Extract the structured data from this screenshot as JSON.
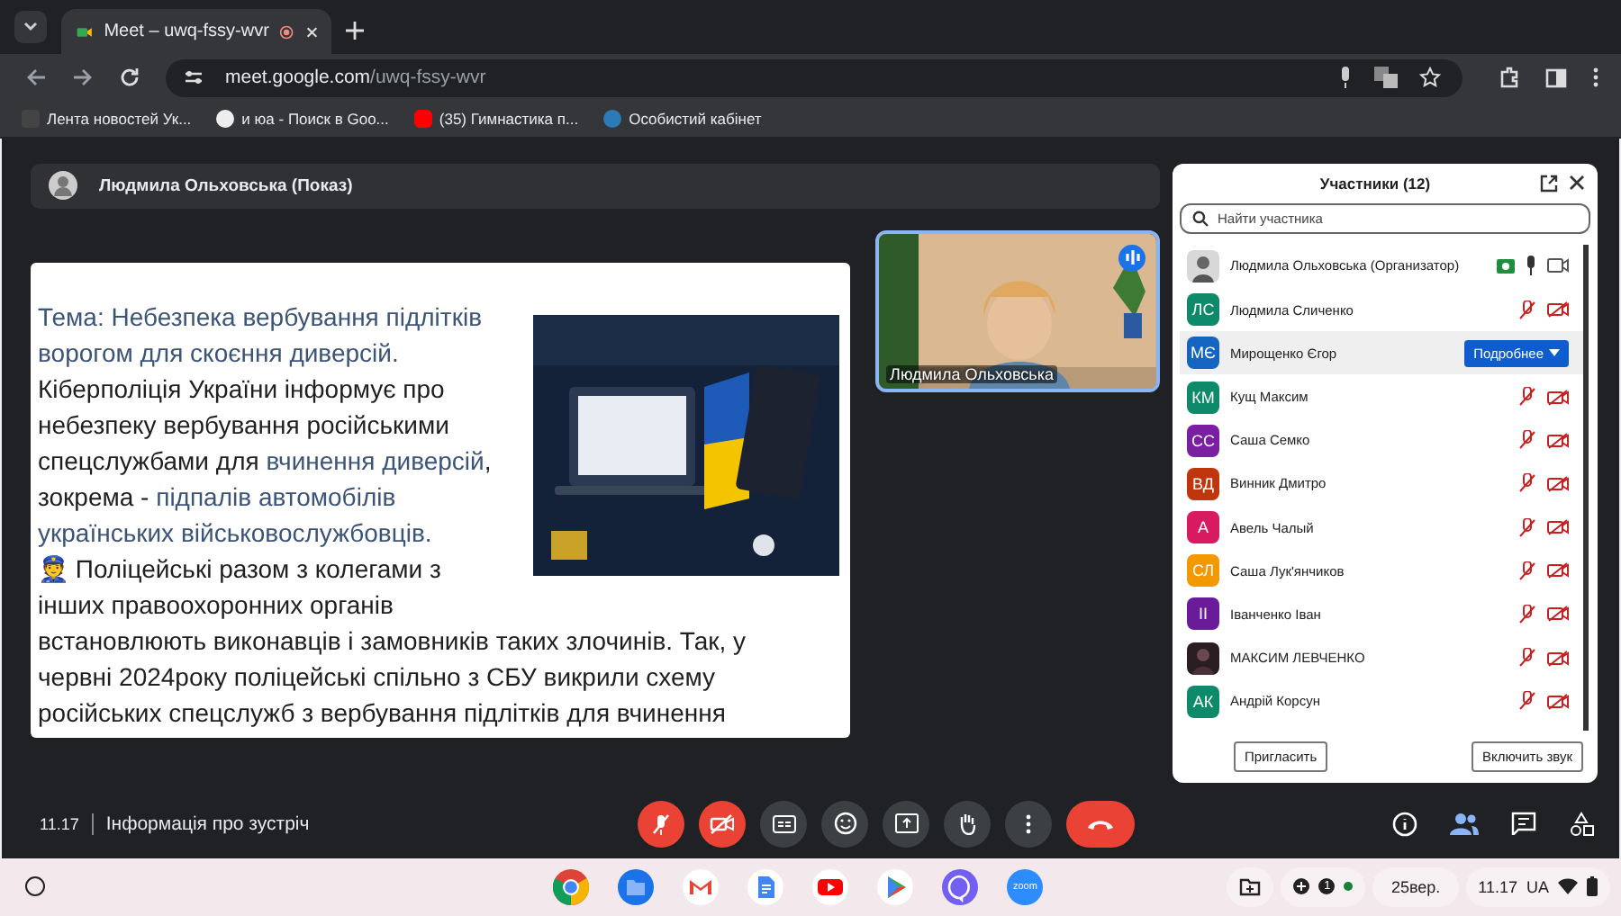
{
  "browser": {
    "tab": {
      "title": "Meet – uwq-fssy-wvr",
      "recording": true
    },
    "url": {
      "host": "meet.google.com",
      "path": "/uwq-fssy-wvr"
    },
    "bookmarks": [
      {
        "label": "Лента новостей Ук..."
      },
      {
        "label": "и юа - Поиск в Goo..."
      },
      {
        "label": "(35) Гимнастика п..."
      },
      {
        "label": "Особистий кабінет"
      }
    ]
  },
  "presenter_bar": {
    "label": "Людмила Ольховська (Показ)"
  },
  "slide": {
    "bottom_text": "встановлюють виконавців і замовників таких злочинів. Так, у червні 2024року поліцейські спільно з СБУ викрили схему російських спецслужб з вербування підлітків для вчинення",
    "paragraphs": [
      {
        "segments": [
          {
            "text": "Тема: Небезпека вербування підлітків ворогом для скоєння диверсій.",
            "accent": true
          }
        ]
      },
      {
        "segments": [
          {
            "text": "Кіберполіція України інформує про небезпеку вербування російськими спецслужбами для ",
            "accent": false
          },
          {
            "text": "вчинення диверсій",
            "accent": true
          },
          {
            "text": ", зокрема - ",
            "accent": false
          },
          {
            "text": "підпалів автомобілів українських військовослужбовців.",
            "accent": true
          }
        ]
      },
      {
        "segments": [
          {
            "text": "👮 Поліцейські разом з колегами з інших правоохоронних органів",
            "accent": false
          }
        ]
      }
    ]
  },
  "video_tile": {
    "name": "Людмила Ольховська",
    "speaking": true
  },
  "participants": {
    "title": "Участники (12)",
    "search": {
      "placeholder": "Найти участника"
    },
    "details_button": "Подробнее",
    "items": [
      {
        "name": "Людмила Ольховська (Организатор)",
        "muted": false,
        "selected": false
      },
      {
        "kind": "initials",
        "initials": "ЛС",
        "color": "#0e8a6a",
        "name": "Людмила Сличенко",
        "muted": true,
        "selected": false
      },
      {
        "kind": "initials",
        "initials": "МЄ",
        "color": "#1565c0",
        "name": "Мирощенко Єгор",
        "selected": true
      },
      {
        "kind": "initials",
        "initials": "КМ",
        "color": "#0e8a6a",
        "name": "Кущ Максим",
        "muted": true,
        "selected": false
      },
      {
        "kind": "initials",
        "initials": "СС",
        "color": "#7b1fa2",
        "name": "Саша Семко",
        "muted": true,
        "selected": false
      },
      {
        "kind": "initials",
        "initials": "ВД",
        "color": "#bf360c",
        "name": "Винник Дмитро",
        "muted": true,
        "selected": false
      },
      {
        "kind": "initials",
        "initials": "А",
        "color": "#d81b60",
        "name": "Авель Чалый",
        "muted": true,
        "selected": false
      },
      {
        "kind": "initials",
        "initials": "СЛ",
        "color": "#f29900",
        "name": "Саша Лук'янчиков",
        "muted": true,
        "selected": false
      },
      {
        "kind": "initials",
        "initials": "ІІ",
        "color": "#6a1b9a",
        "name": "Іванченко Іван",
        "muted": true,
        "selected": false
      },
      {
        "name": "МАКСИМ ЛЕВЧЕНКО",
        "muted": true,
        "selected": false
      },
      {
        "kind": "initials",
        "initials": "АК",
        "color": "#0e8a6a",
        "name": "Андрій Корсун",
        "muted": true,
        "selected": false
      }
    ],
    "buttons": [
      "Пригласить",
      "Включить звук"
    ]
  },
  "meeting_bar": {
    "time": "11.17",
    "info": "Інформація про зустріч",
    "mic_on": false,
    "camera_on": false,
    "participants_panel_open": true
  },
  "taskbar": {
    "zoom_label": "zoom",
    "notification_count": "1",
    "date": "25вер.",
    "time": "11.17",
    "language": "UA"
  }
}
